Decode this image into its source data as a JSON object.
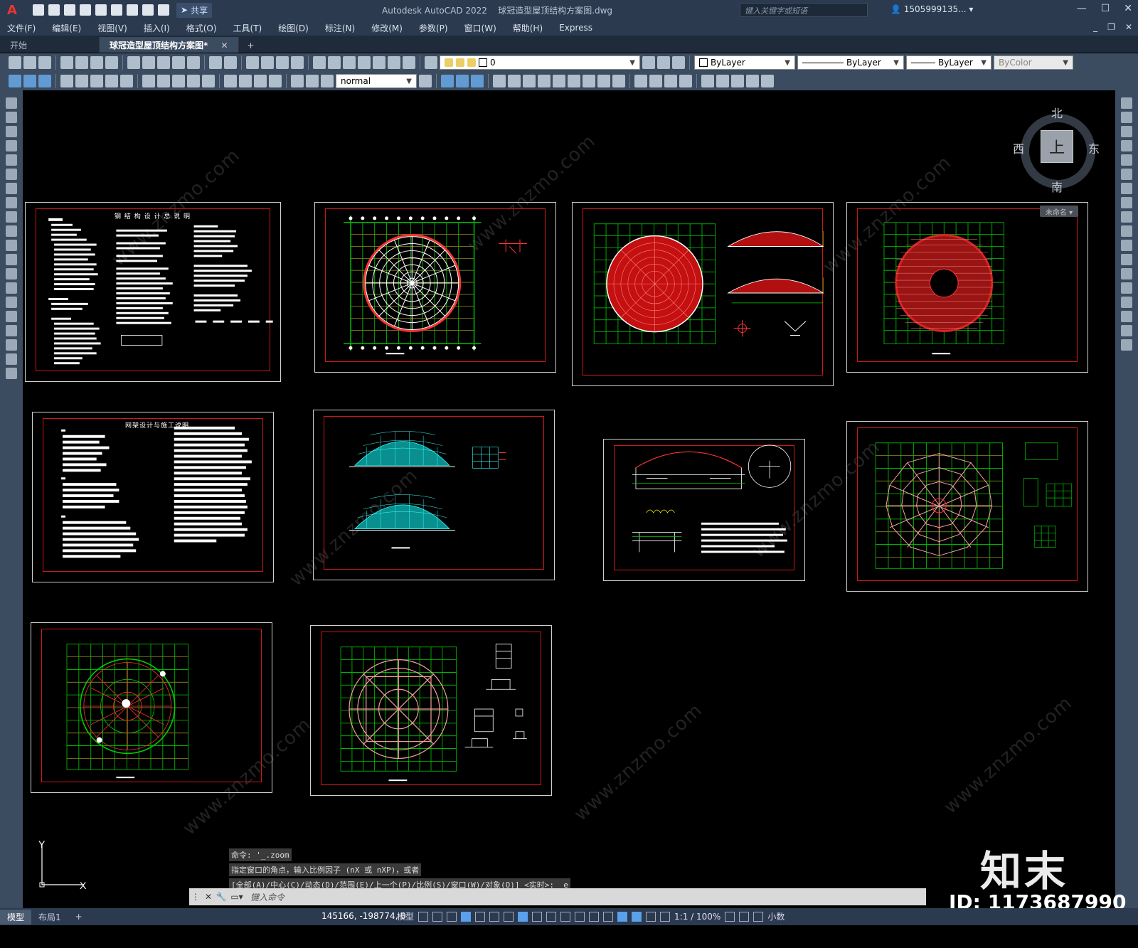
{
  "titlebar": {
    "app_title": "Autodesk AutoCAD 2022",
    "file_title": "球冠造型屋顶结构方案图.dwg",
    "share_label": "共享",
    "search_placeholder": "键入关键字或短语",
    "user": "1505999135... ▾"
  },
  "menubar": {
    "items": [
      "文件(F)",
      "编辑(E)",
      "视图(V)",
      "插入(I)",
      "格式(O)",
      "工具(T)",
      "绘图(D)",
      "标注(N)",
      "修改(M)",
      "参数(P)",
      "窗口(W)",
      "帮助(H)",
      "Express"
    ]
  },
  "filetabs": {
    "start": "开始",
    "active": "球冠造型屋顶结构方案图*",
    "close": "✕",
    "add": "+"
  },
  "toolbar": {
    "layer_value": "0",
    "color_value": "ByLayer",
    "linetype_value": "ByLayer",
    "lineweight_value": "ByLayer",
    "plotstyle_value": "ByColor",
    "textstyle_value": "normal"
  },
  "viewcube": {
    "north": "北",
    "south": "南",
    "east": "东",
    "west": "西",
    "face": "上",
    "named": "未命名 ▾"
  },
  "sheets": {
    "s1_title": "钢 结 构 设 计 总 说 明",
    "s5_title": "网架设计与施工说明"
  },
  "ucs": {
    "x": "X",
    "y": "Y"
  },
  "command": {
    "history": [
      "命令: '_.zoom",
      "指定窗口的角点，输入比例因子 (nX 或 nXP)，或者",
      "[全部(A)/中心(C)/动态(D)/范围(E)/上一个(P)/比例(S)/窗口(W)/对象(O)] <实时>: _e"
    ],
    "prompt": "键入命令"
  },
  "brand": {
    "logo": "知末",
    "id": "ID: 1173687990"
  },
  "statusbar": {
    "tab_model": "模型",
    "tab_layout": "布局1",
    "add": "+",
    "coords": "145166, -198774, 0",
    "model_label": "模型",
    "scale": "1:1 / 100%",
    "units": "小数"
  }
}
